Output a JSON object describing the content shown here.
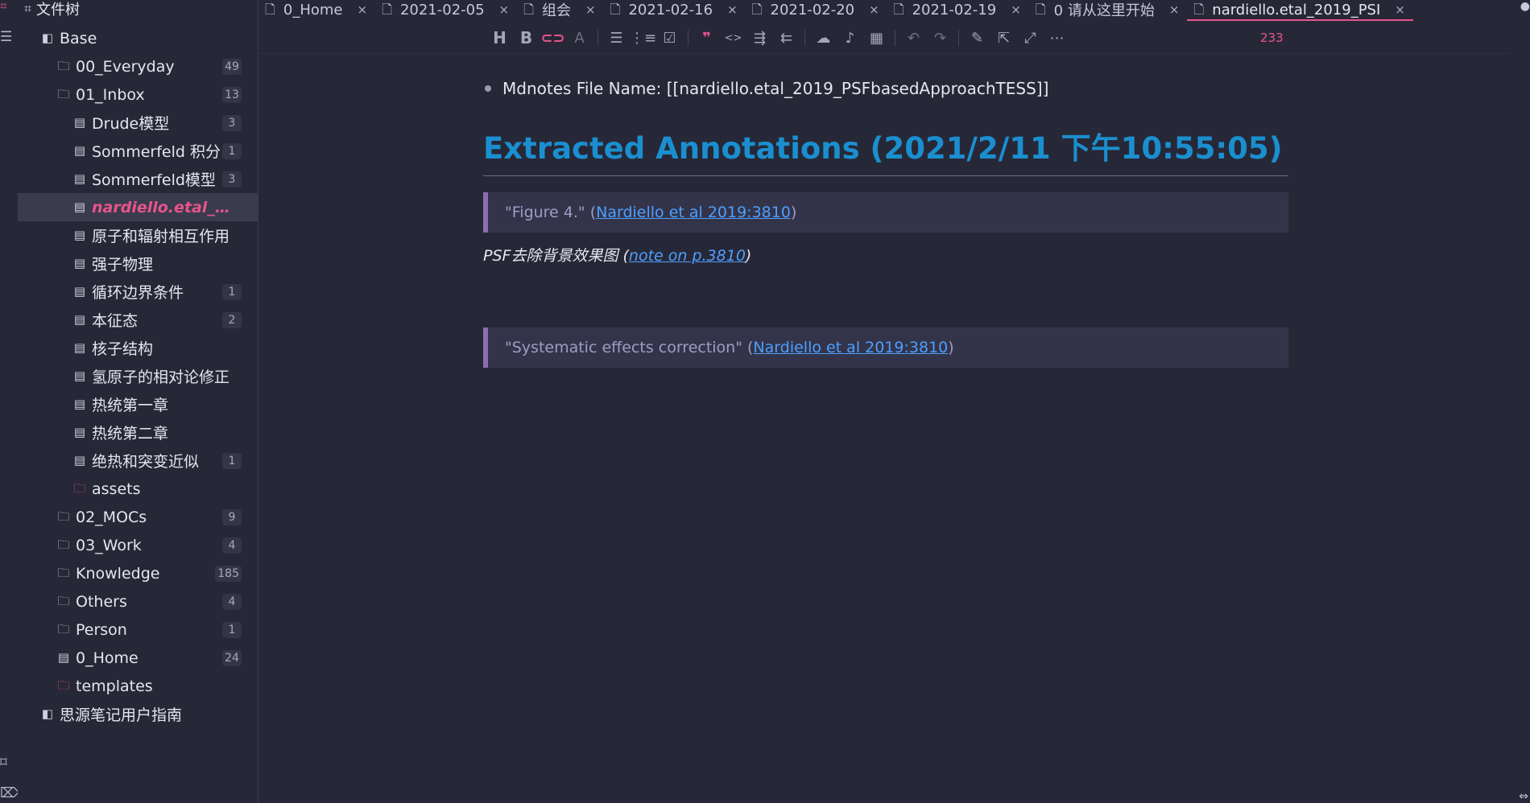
{
  "sidebar": {
    "title": "文件树",
    "tree": [
      {
        "label": "Base",
        "count": "",
        "icon": "notebook-icon",
        "glyph": "◧",
        "depth": 0,
        "pink": false,
        "active": false
      },
      {
        "label": "00_Everyday",
        "count": "49",
        "icon": "folder-icon",
        "glyph": "🗀",
        "depth": 1,
        "pink": false,
        "active": false
      },
      {
        "label": "01_Inbox",
        "count": "13",
        "icon": "folder-icon",
        "glyph": "🗀",
        "depth": 1,
        "pink": false,
        "active": false
      },
      {
        "label": "Drude模型",
        "count": "3",
        "icon": "document-icon",
        "glyph": "▤",
        "depth": 2,
        "pink": false,
        "active": false
      },
      {
        "label": "Sommerfeld 积分",
        "count": "1",
        "icon": "document-icon",
        "glyph": "▤",
        "depth": 2,
        "pink": false,
        "active": false
      },
      {
        "label": "Sommerfeld模型",
        "count": "3",
        "icon": "document-icon",
        "glyph": "▤",
        "depth": 2,
        "pink": false,
        "active": false
      },
      {
        "label": "nardiello.etal_201...",
        "count": "",
        "icon": "document-icon",
        "glyph": "▤",
        "depth": 2,
        "pink": false,
        "active": true
      },
      {
        "label": "原子和辐射相互作用",
        "count": "",
        "icon": "document-icon",
        "glyph": "▤",
        "depth": 2,
        "pink": false,
        "active": false
      },
      {
        "label": "强子物理",
        "count": "",
        "icon": "document-icon",
        "glyph": "▤",
        "depth": 2,
        "pink": false,
        "active": false
      },
      {
        "label": "循环边界条件",
        "count": "1",
        "icon": "document-icon",
        "glyph": "▤",
        "depth": 2,
        "pink": false,
        "active": false
      },
      {
        "label": "本征态",
        "count": "2",
        "icon": "document-icon",
        "glyph": "▤",
        "depth": 2,
        "pink": false,
        "active": false
      },
      {
        "label": "核子结构",
        "count": "",
        "icon": "document-icon",
        "glyph": "▤",
        "depth": 2,
        "pink": false,
        "active": false
      },
      {
        "label": "氢原子的相对论修正",
        "count": "",
        "icon": "document-icon",
        "glyph": "▤",
        "depth": 2,
        "pink": false,
        "active": false
      },
      {
        "label": "热统第一章",
        "count": "",
        "icon": "document-icon",
        "glyph": "▤",
        "depth": 2,
        "pink": false,
        "active": false
      },
      {
        "label": "热统第二章",
        "count": "",
        "icon": "document-icon",
        "glyph": "▤",
        "depth": 2,
        "pink": false,
        "active": false
      },
      {
        "label": "绝热和突变近似",
        "count": "1",
        "icon": "document-icon",
        "glyph": "▤",
        "depth": 2,
        "pink": false,
        "active": false
      },
      {
        "label": "assets",
        "count": "",
        "icon": "folder-icon",
        "glyph": "🗀",
        "depth": 2,
        "pink": true,
        "active": false
      },
      {
        "label": "02_MOCs",
        "count": "9",
        "icon": "folder-icon",
        "glyph": "🗀",
        "depth": 1,
        "pink": false,
        "active": false
      },
      {
        "label": "03_Work",
        "count": "4",
        "icon": "folder-icon",
        "glyph": "🗀",
        "depth": 1,
        "pink": false,
        "active": false
      },
      {
        "label": "Knowledge",
        "count": "185",
        "icon": "folder-icon",
        "glyph": "🗀",
        "depth": 1,
        "pink": false,
        "active": false
      },
      {
        "label": "Others",
        "count": "4",
        "icon": "folder-icon",
        "glyph": "🗀",
        "depth": 1,
        "pink": false,
        "active": false
      },
      {
        "label": "Person",
        "count": "1",
        "icon": "folder-icon",
        "glyph": "🗀",
        "depth": 1,
        "pink": false,
        "active": false
      },
      {
        "label": "0_Home",
        "count": "24",
        "icon": "document-icon",
        "glyph": "▤",
        "depth": 1,
        "pink": false,
        "active": false
      },
      {
        "label": "templates",
        "count": "",
        "icon": "folder-icon",
        "glyph": "🗀",
        "depth": 1,
        "pink": true,
        "active": false
      },
      {
        "label": "思源笔记用户指南",
        "count": "",
        "icon": "notebook-icon",
        "glyph": "◧",
        "depth": 0,
        "pink": false,
        "active": false
      }
    ]
  },
  "tabs": [
    {
      "label": "0_Home",
      "active": false
    },
    {
      "label": "2021-02-05",
      "active": false
    },
    {
      "label": "组会",
      "active": false
    },
    {
      "label": "2021-02-16",
      "active": false
    },
    {
      "label": "2021-02-20",
      "active": false
    },
    {
      "label": "2021-02-19",
      "active": false
    },
    {
      "label": "0 请从这里开始",
      "active": false
    },
    {
      "label": "nardiello.etal_2019_PSI",
      "active": true
    }
  ],
  "toolbar": {
    "word_count": "233"
  },
  "editor": {
    "bullet_text": "Mdnotes File Name: [[nardiello.etal_2019_PSFbasedApproachTESS]]",
    "heading": "Extracted Annotations (2021/2/11 下午10:55:05)",
    "quote1": {
      "prefix": "\"Figure 4.\" (",
      "link": "Nardiello et al 2019:3810",
      "suffix": ")"
    },
    "note": {
      "prefix": "PSF去除背景效果图 (",
      "link": "note on p.3810",
      "suffix": ")"
    },
    "quote2": {
      "prefix": "\"Systematic effects correction\" (",
      "link": "Nardiello et al 2019:3810",
      "suffix": ")"
    }
  },
  "colors": {
    "background": "#272837",
    "accent_pink": "#e7548d",
    "heading_blue": "#1a8fd0",
    "link_blue": "#4d9fff",
    "quote_border": "#8b6fb0"
  }
}
